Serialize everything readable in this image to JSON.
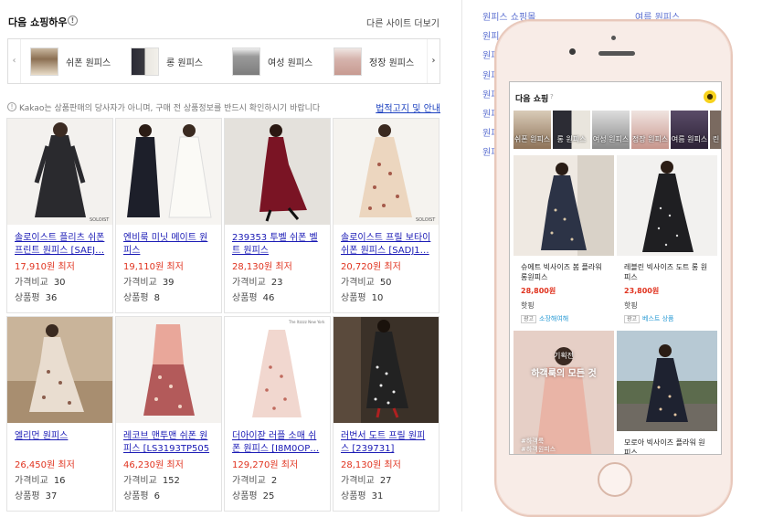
{
  "header": {
    "title": "다음 쇼핑하우",
    "info_icon": "!",
    "more_link": "다른 사이트 더보기"
  },
  "categories": {
    "prev_icon": "‹",
    "next_icon": "›",
    "items": [
      {
        "label": "쉬폰 원피스"
      },
      {
        "label": "롱 원피스"
      },
      {
        "label": "여성 원피스"
      },
      {
        "label": "정장 원피스"
      }
    ]
  },
  "notice": {
    "icon": "!",
    "text": "Kakao는 상품판매의 당사자가 아니며, 구매 전 상품정보를 반드시 확인하시기 바랍니다",
    "link": "법적고지 및 안내"
  },
  "labels": {
    "compare": "가격비교",
    "reviews": "상품평"
  },
  "products": [
    {
      "name": "솔로이스트 플리츠 쉬폰 프린트 원피스 [SAEJ…",
      "price": "17,910원 최저",
      "compare": "30",
      "reviews": "36",
      "watermark": "SOLOIST"
    },
    {
      "name": "엔비룩 미닛 메이트 원피스",
      "price": "19,110원 최저",
      "compare": "39",
      "reviews": "8",
      "watermark": ""
    },
    {
      "name": "239353 투벨 쉬폰 벨트 원피스",
      "price": "28,130원 최저",
      "compare": "23",
      "reviews": "46",
      "watermark": ""
    },
    {
      "name": "솔로이스트 프릴 보타이 쉬폰 원피스 [SADJ1…",
      "price": "20,720원 최저",
      "compare": "50",
      "reviews": "10",
      "watermark": "SOLOIST"
    },
    {
      "name": "엘리먼 원피스",
      "price": "26,450원 최저",
      "compare": "16",
      "reviews": "37",
      "watermark": ""
    },
    {
      "name": "레코브 맨투맨 쉬폰 원피스 [LS3193TP505S]",
      "price": "46,230원 최저",
      "compare": "152",
      "reviews": "6",
      "watermark": ""
    },
    {
      "name": "더아이잗 러플 소매 쉬폰 원피스 [I8M0OP…",
      "price": "129,270원 최저",
      "compare": "2",
      "reviews": "25",
      "watermark": "The Itzzzz New York"
    },
    {
      "name": "러번서 도트 프릴 원피스 [239731]",
      "price": "28,130원 최저",
      "compare": "27",
      "reviews": "31",
      "watermark": ""
    }
  ],
  "right_links": [
    {
      "label": "원피스 쇼핑몰"
    },
    {
      "label": "여름 원피스"
    },
    {
      "label": "원피"
    },
    {
      "label": "원피"
    },
    {
      "label": "원피"
    },
    {
      "label": "원피"
    },
    {
      "label": "원피"
    },
    {
      "label": "원피"
    },
    {
      "label": "원피"
    }
  ],
  "phone": {
    "title": "다음 쇼핑",
    "help": "?",
    "kakao_icon": "●",
    "cats": [
      "쉬폰 원피스",
      "롱 원피스",
      "여성 원피스",
      "정장 원피스",
      "여름 원피스",
      "린"
    ],
    "items": [
      {
        "name": "슈에트 빅사이즈 봄 플라워 롱원피스",
        "price": "28,800원",
        "shop": "핫핑",
        "badge": "광고",
        "tag": "소장해여해"
      },
      {
        "name": "레블린 빅사이즈 도트 롱 원피스",
        "price": "23,800원",
        "shop": "핫핑",
        "badge": "광고",
        "tag": "베스트 상품"
      }
    ],
    "promo": {
      "top": "기획전",
      "headline": "하객룩의 모든 것",
      "hashtag1": "#하객룩",
      "hashtag2": "#하객원피스"
    },
    "item3": {
      "name": "모로아 빅사이즈 플라워 원피스"
    }
  }
}
